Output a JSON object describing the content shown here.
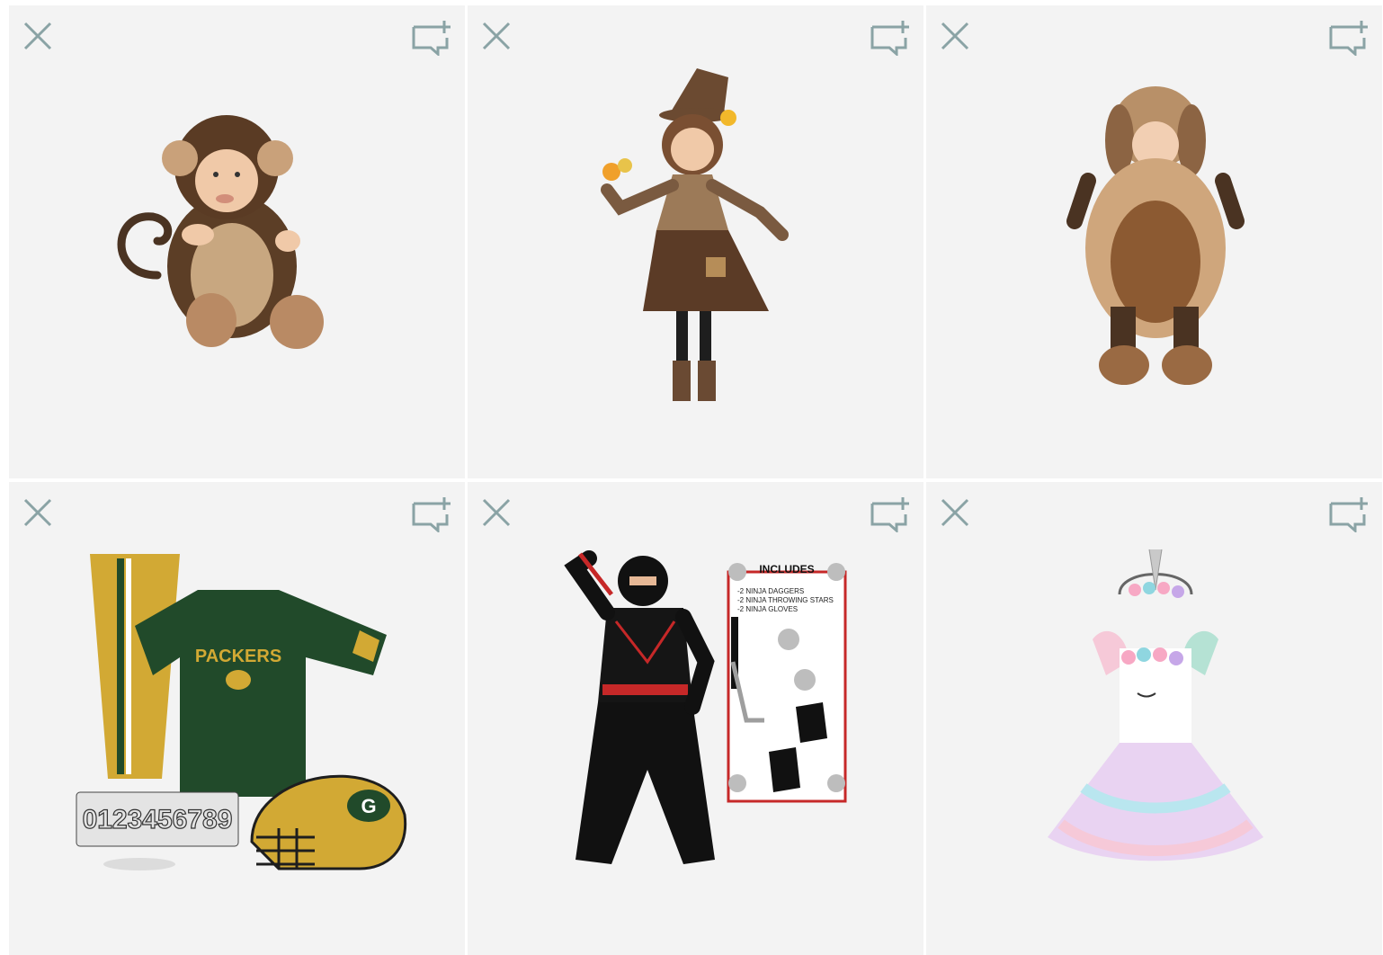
{
  "products": [
    {
      "name": "Monkey baby costume",
      "icon": "monkey-costume-image"
    },
    {
      "name": "Scarecrow girl costume",
      "icon": "scarecrow-costume-image"
    },
    {
      "name": "Puppy toddler costume",
      "icon": "puppy-costume-image"
    },
    {
      "name": "Packers football uniform set",
      "icon": "packers-uniform-image",
      "jersey_text": "PACKERS",
      "helmet_text": "G",
      "numbers_text": "0123456789"
    },
    {
      "name": "Ninja costume set",
      "icon": "ninja-costume-image",
      "includes_title": "INCLUDES",
      "includes_items": [
        "-2 NINJA DAGGERS",
        "-2 NINJA THROWING STARS",
        "-2 NINJA GLOVES"
      ]
    },
    {
      "name": "Unicorn tutu dress",
      "icon": "unicorn-dress-image"
    }
  ],
  "actions": {
    "close_icon": "close-icon",
    "add_icon": "add-to-list-icon"
  },
  "colors": {
    "tile_bg": "#f3f3f3",
    "icon_color": "#8aa3a5"
  }
}
